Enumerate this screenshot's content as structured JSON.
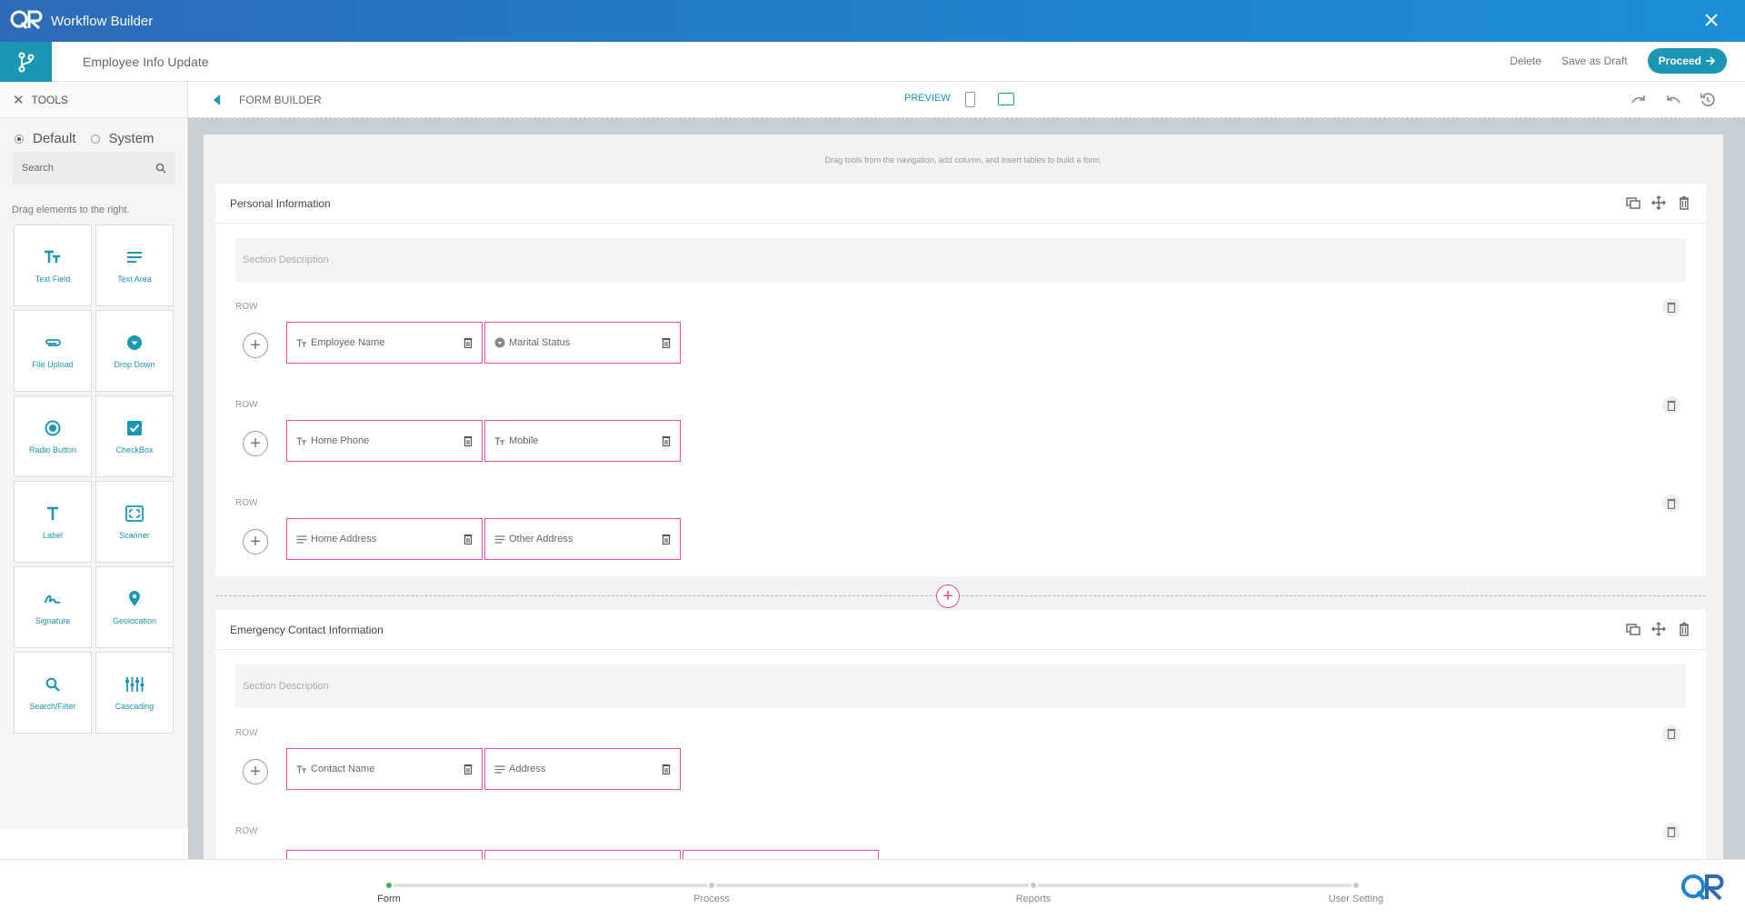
{
  "app": {
    "title": "Workflow Builder"
  },
  "header": {
    "document_name": "Employee Info Update",
    "delete_label": "Delete",
    "save_draft_label": "Save as Draft",
    "proceed_label": "Proceed"
  },
  "tools": {
    "title": "TOOLS",
    "radio_default": "Default",
    "radio_system": "System",
    "selected_radio": "Default",
    "search_placeholder": "Search",
    "drag_hint": "Drag elements to the right.",
    "items": [
      {
        "label": "Text Field",
        "icon": "text-field-icon"
      },
      {
        "label": "Text Area",
        "icon": "text-area-icon"
      },
      {
        "label": "File Upload",
        "icon": "paperclip-icon"
      },
      {
        "label": "Drop Down",
        "icon": "dropdown-icon"
      },
      {
        "label": "Radio Button",
        "icon": "radio-icon"
      },
      {
        "label": "CheckBox",
        "icon": "checkbox-icon"
      },
      {
        "label": "Label",
        "icon": "label-icon"
      },
      {
        "label": "Scanner",
        "icon": "scanner-icon"
      },
      {
        "label": "Signature",
        "icon": "signature-icon"
      },
      {
        "label": "Geolocation",
        "icon": "location-pin-icon"
      },
      {
        "label": "Search/Filter",
        "icon": "search-icon"
      },
      {
        "label": "Cascading",
        "icon": "cascading-icon"
      }
    ]
  },
  "builder": {
    "title": "FORM BUILDER",
    "preview_label": "PREVIEW",
    "active_device": "desktop",
    "drag_hint": "Drag tools from the navigation, add column, and insert tables to build a form.",
    "row_label": "ROW",
    "sections": [
      {
        "title": "Personal Information",
        "description_placeholder": "Section Description",
        "rows": [
          [
            {
              "label": "Employee Name",
              "type": "text"
            },
            {
              "label": "Marital Status",
              "type": "dropdown"
            }
          ],
          [
            {
              "label": "Home Phone",
              "type": "text"
            },
            {
              "label": "Mobile",
              "type": "text"
            }
          ],
          [
            {
              "label": "Home Address",
              "type": "textarea"
            },
            {
              "label": "Other Address",
              "type": "textarea"
            }
          ]
        ]
      },
      {
        "title": "Emergency Contact Information",
        "description_placeholder": "Section Description",
        "rows": [
          [
            {
              "label": "Contact Name",
              "type": "text"
            },
            {
              "label": "Address",
              "type": "textarea"
            }
          ]
        ]
      }
    ]
  },
  "stepper": {
    "steps": [
      "Form",
      "Process",
      "Reports",
      "User Setting"
    ],
    "active": "Form"
  },
  "colors": {
    "accent": "#1b96b4",
    "field_border": "#e04ca8",
    "titlebar": "#1f83cf",
    "active_step": "#4caf50"
  }
}
